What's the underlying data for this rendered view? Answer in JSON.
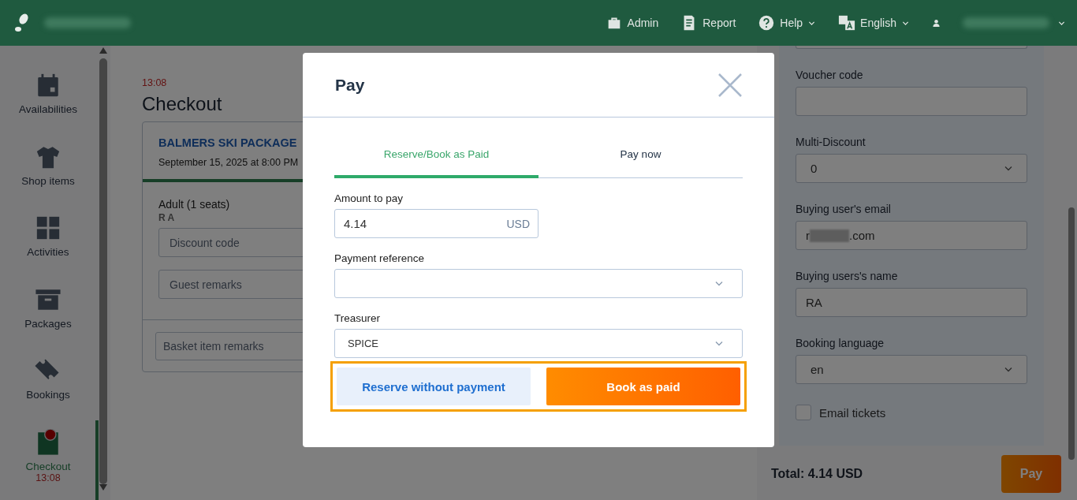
{
  "top_bar": {
    "menu": [
      {
        "label": "Admin",
        "kind": "briefcase",
        "dropdown": false
      },
      {
        "label": "Report",
        "kind": "document",
        "dropdown": false
      },
      {
        "label": "Help",
        "kind": "question",
        "dropdown": true
      },
      {
        "label": "English",
        "kind": "translate",
        "dropdown": true
      }
    ],
    "user": {
      "dropdown": true
    }
  },
  "sidebar": {
    "items": [
      {
        "label": "Availabilities",
        "kind": "calendar",
        "selected": false
      },
      {
        "label": "Shop items",
        "kind": "shirt",
        "selected": false
      },
      {
        "label": "Activities",
        "kind": "grid",
        "selected": false
      },
      {
        "label": "Packages",
        "kind": "box",
        "selected": false
      },
      {
        "label": "Bookings",
        "kind": "ticket",
        "selected": false
      },
      {
        "label": "Checkout",
        "kind": "checkout",
        "selected": true,
        "timer": "13:08"
      }
    ]
  },
  "checkout": {
    "timer": "13:08",
    "title": "Checkout",
    "package": {
      "name": "BALMERS SKI PACKAGE",
      "date": "September 15, 2025 at 8:00 PM"
    },
    "ticket": {
      "type": "Adult",
      "seats": "(1 seats)",
      "guest": "R A"
    },
    "fields": [
      {
        "placeholder": "Discount code"
      },
      {
        "placeholder": "Guest remarks"
      }
    ],
    "basket_remarks": {
      "placeholder": "Basket item remarks"
    }
  },
  "details": {
    "fields": [
      {
        "label": "Voucher code",
        "kind": "text"
      },
      {
        "label": "Multi-Discount",
        "kind": "select",
        "value": "0"
      },
      {
        "label": "Buying user's email",
        "kind": "email",
        "value_start": "r",
        "value_end": ".com"
      },
      {
        "label": "Buying users's name",
        "kind": "text",
        "value": "RA"
      },
      {
        "label": "Booking language",
        "kind": "select",
        "value": "en"
      }
    ],
    "email_tickets": {
      "label": "Email tickets",
      "checked": false
    },
    "total": "Total: 4.14 USD",
    "pay_button": "Pay"
  },
  "dialog": {
    "title": "Pay",
    "tabs": [
      {
        "label": "Reserve/Book as Paid",
        "selected": true
      },
      {
        "label": "Pay now",
        "selected": false
      }
    ],
    "amount": {
      "label": "Amount to pay",
      "value": "4.14",
      "currency": "USD"
    },
    "payment_reference": {
      "label": "Payment reference"
    },
    "treasurer": {
      "label": "Treasurer",
      "value": "SPICE"
    },
    "buttons": [
      {
        "label": "Reserve without payment",
        "kind": "secondary"
      },
      {
        "label": "Book as paid",
        "kind": "primary"
      }
    ],
    "highlighted": true
  }
}
